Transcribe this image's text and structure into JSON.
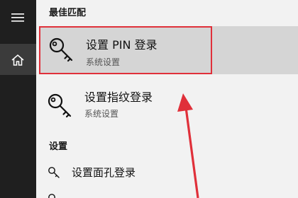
{
  "sidebar": {
    "menu_icon": "hamburger-icon",
    "home_icon": "home-icon"
  },
  "best_match": {
    "header": "最佳匹配",
    "results": [
      {
        "title": "设置 PIN 登录",
        "subtitle": "系统设置",
        "icon": "key-icon",
        "selected": true
      },
      {
        "title": "设置指纹登录",
        "subtitle": "系统设置",
        "icon": "key-icon",
        "selected": false
      }
    ]
  },
  "settings": {
    "header": "设置",
    "items": [
      {
        "label": "设置面孔登录",
        "icon": "key-icon"
      }
    ]
  },
  "colors": {
    "rail_bg": "#1f1f1f",
    "selected_bg": "#d5d5d5",
    "highlight_border": "#e0303a",
    "annotation_arrow": "#e0303a"
  }
}
